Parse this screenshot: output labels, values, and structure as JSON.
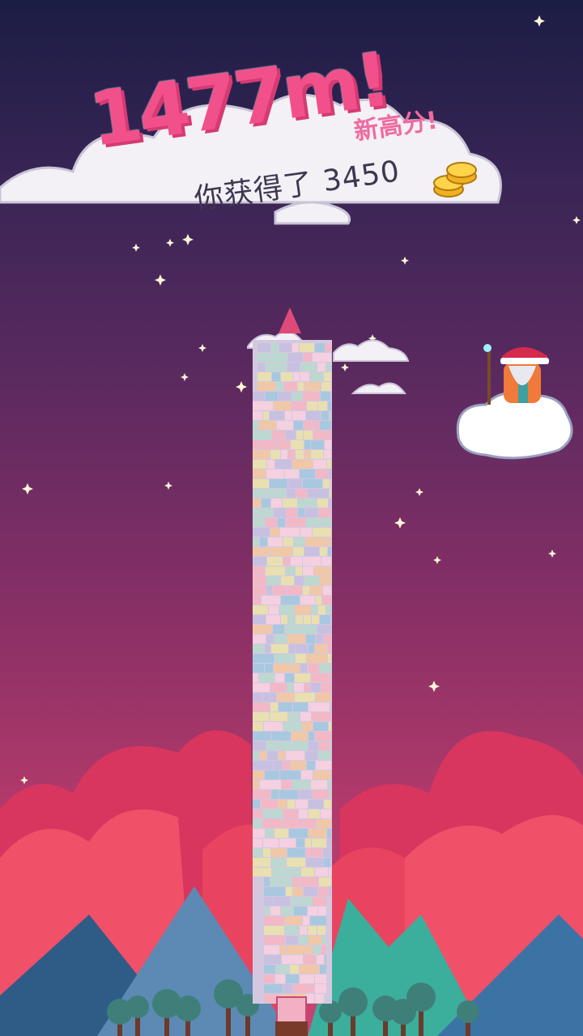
{
  "result": {
    "height": "1477m!",
    "new_high_label": "新高分!",
    "earned_prefix": "你获得了",
    "coins": "3450"
  },
  "icons": {
    "coins": "gold-coin-stack-icon",
    "wizard": "wizard-on-cloud",
    "tower_top": "pink-spire"
  },
  "colors": {
    "score_pink": "#f2508a",
    "sky_top": "#1b1d45",
    "sky_bottom": "#c94470",
    "cloud": "#f3f1f6"
  }
}
